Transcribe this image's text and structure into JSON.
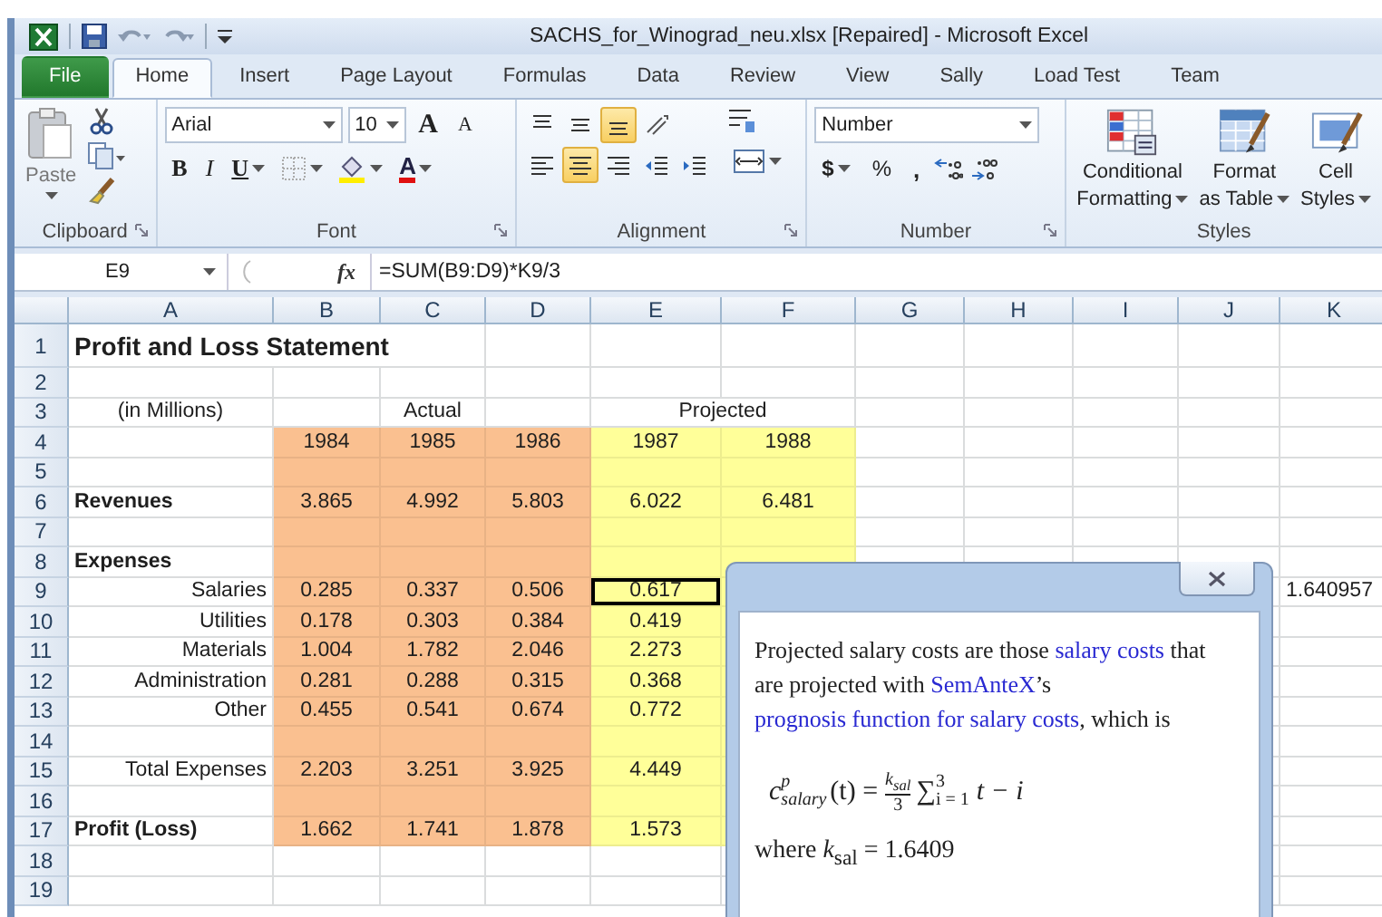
{
  "window": {
    "title": "SACHS_for_Winograd_neu.xlsx [Repaired]  -  Microsoft Excel"
  },
  "tabs": [
    {
      "label": "File",
      "kind": "file",
      "selected": false
    },
    {
      "label": "Home",
      "kind": "tab",
      "selected": true
    },
    {
      "label": "Insert",
      "kind": "tab",
      "selected": false
    },
    {
      "label": "Page Layout",
      "kind": "tab",
      "selected": false
    },
    {
      "label": "Formulas",
      "kind": "tab",
      "selected": false
    },
    {
      "label": "Data",
      "kind": "tab",
      "selected": false
    },
    {
      "label": "Review",
      "kind": "tab",
      "selected": false
    },
    {
      "label": "View",
      "kind": "tab",
      "selected": false
    },
    {
      "label": "Sally",
      "kind": "tab",
      "selected": false
    },
    {
      "label": "Load Test",
      "kind": "tab",
      "selected": false
    },
    {
      "label": "Team",
      "kind": "tab",
      "selected": false
    }
  ],
  "ribbon": {
    "clipboard": {
      "label": "Clipboard",
      "paste": "Paste"
    },
    "font": {
      "label": "Font",
      "name": "Arial",
      "size": "10",
      "grow": "A",
      "shrink": "A",
      "bold": "B",
      "italic": "I",
      "underline": "U",
      "font_color": "A"
    },
    "alignment": {
      "label": "Alignment",
      "vertical": [
        {
          "kind": "top",
          "selected": false
        },
        {
          "kind": "middle",
          "selected": false
        },
        {
          "kind": "bottom",
          "selected": true
        },
        {
          "kind": "orient",
          "selected": false
        }
      ],
      "horizontal": [
        {
          "kind": "left",
          "selected": false
        },
        {
          "kind": "center",
          "selected": true
        },
        {
          "kind": "right",
          "selected": false
        },
        {
          "kind": "outdent",
          "selected": false
        },
        {
          "kind": "indent",
          "selected": false
        }
      ]
    },
    "number": {
      "label": "Number",
      "format": "Number",
      "currency": "$",
      "percent": "%",
      "comma": ","
    },
    "styles": {
      "label": "Styles",
      "buttons": [
        {
          "kind": "conditional",
          "lines": [
            "Conditional",
            "Formatting"
          ]
        },
        {
          "kind": "table",
          "lines": [
            "Format",
            "as Table"
          ]
        },
        {
          "kind": "cell",
          "lines": [
            "Cell",
            "Styles"
          ]
        }
      ]
    }
  },
  "formula_bar": {
    "name_box": "E9",
    "fx": "fx",
    "formula": "=SUM(B9:D9)*K9/3"
  },
  "sheet": {
    "columns": [
      {
        "label": "A"
      },
      {
        "label": "B",
        "color": "#fac090"
      },
      {
        "label": "C",
        "color": "#fac090"
      },
      {
        "label": "D",
        "color": "#fac090"
      },
      {
        "label": "E",
        "color": "#ffff99"
      },
      {
        "label": "F",
        "color": "#ffff99"
      },
      {
        "label": "G"
      },
      {
        "label": "H"
      },
      {
        "label": "I"
      },
      {
        "label": "J"
      },
      {
        "label": "K"
      }
    ],
    "rows": [
      {
        "number": "1",
        "kind": "title",
        "shaded": false,
        "cells": [
          "Profit and Loss Statement"
        ]
      },
      {
        "number": "2",
        "kind": "plain",
        "shaded": false
      },
      {
        "number": "3",
        "kind": "subheader",
        "shaded": false,
        "cells": [
          "(in Millions)",
          null,
          "Actual",
          null,
          {
            "text": "Projected",
            "merged_with_next": true
          }
        ]
      },
      {
        "number": "4",
        "kind": "plain",
        "shaded": true,
        "cells": [
          null,
          "1984",
          "1985",
          "1986",
          "1987",
          "1988"
        ]
      },
      {
        "number": "5",
        "kind": "plain",
        "shaded": true
      },
      {
        "number": "6",
        "kind": "heading",
        "shaded": true,
        "cells": [
          "Revenues",
          "3.865",
          "4.992",
          "5.803",
          "6.022",
          "6.481"
        ]
      },
      {
        "number": "7",
        "kind": "plain",
        "shaded": true
      },
      {
        "number": "8",
        "kind": "heading",
        "shaded": true,
        "cells": [
          "Expenses"
        ]
      },
      {
        "number": "9",
        "kind": "item",
        "shaded": true,
        "cells": [
          "Salaries",
          "0.285",
          "0.337",
          "0.506",
          {
            "text": "0.617",
            "selected": true
          },
          null,
          null,
          null,
          null,
          null,
          "1.640957"
        ]
      },
      {
        "number": "10",
        "kind": "item",
        "shaded": true,
        "cells": [
          "Utilities",
          "0.178",
          "0.303",
          "0.384",
          "0.419"
        ]
      },
      {
        "number": "11",
        "kind": "item",
        "shaded": true,
        "cells": [
          "Materials",
          "1.004",
          "1.782",
          "2.046",
          "2.273"
        ]
      },
      {
        "number": "12",
        "kind": "item",
        "shaded": true,
        "cells": [
          "Administration",
          "0.281",
          "0.288",
          "0.315",
          "0.368"
        ]
      },
      {
        "number": "13",
        "kind": "item",
        "shaded": true,
        "cells": [
          "Other",
          "0.455",
          "0.541",
          "0.674",
          "0.772"
        ]
      },
      {
        "number": "14",
        "kind": "plain",
        "shaded": true
      },
      {
        "number": "15",
        "kind": "item",
        "shaded": true,
        "cells": [
          "Total Expenses",
          "2.203",
          "3.251",
          "3.925",
          "4.449"
        ]
      },
      {
        "number": "16",
        "kind": "plain",
        "shaded": true
      },
      {
        "number": "17",
        "kind": "heading",
        "shaded": true,
        "cells": [
          "Profit (Loss)",
          "1.662",
          "1.741",
          "1.878",
          "1.573"
        ]
      },
      {
        "number": "18",
        "kind": "plain",
        "shaded": false
      },
      {
        "number": "19",
        "kind": "plain",
        "shaded": false
      }
    ]
  },
  "popup": {
    "paragraph": [
      {
        "text": "Projected salary costs are those ",
        "link": false
      },
      {
        "text": "salary costs",
        "link": true
      },
      {
        "text": " that are projected with ",
        "link": false
      },
      {
        "text": "SemAnteX",
        "link": true
      },
      {
        "text": "’s ",
        "link": false
      },
      {
        "text": "prognosis function for salary costs",
        "link": true
      },
      {
        "text": ", which is",
        "link": false
      }
    ],
    "formula": {
      "lhs": "c",
      "lhs_sup": "p",
      "lhs_sub": "salary",
      "arg": "(t) =",
      "num": "k$_{sal}$",
      "den": "3",
      "op": "∑",
      "op_sup": "3",
      "op_sub": "i = 1",
      "rest": "t − i"
    },
    "where": "where *k*$_{sal}$ = 1.6409"
  }
}
